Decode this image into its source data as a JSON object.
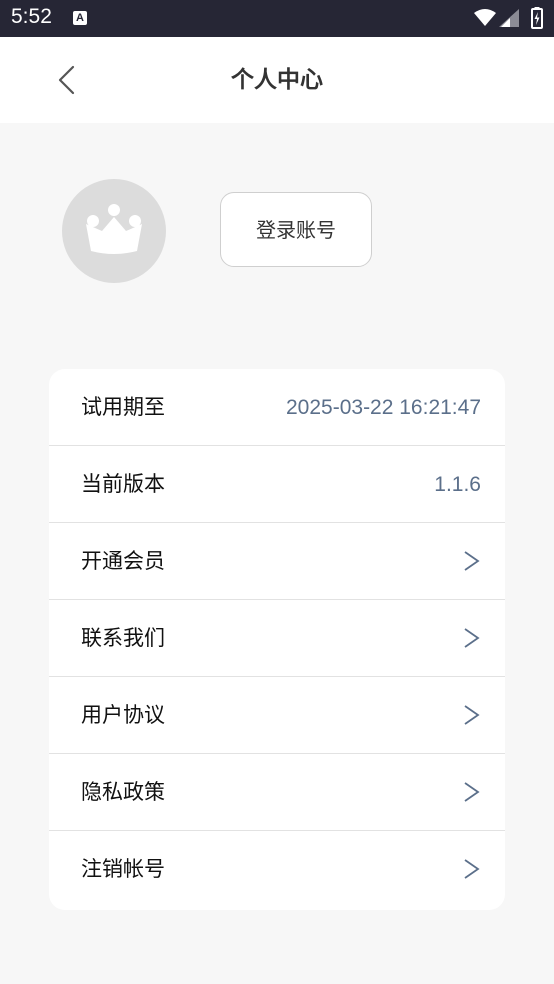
{
  "status_bar": {
    "time": "5:52",
    "notification_badge": "A",
    "icons": [
      "wifi-icon",
      "signal-icon",
      "battery-icon"
    ]
  },
  "header": {
    "title": "个人中心",
    "back_icon": "back-arrow-icon"
  },
  "profile": {
    "avatar_icon": "crown-icon",
    "login_label": "登录账号"
  },
  "menu": {
    "trial": {
      "label": "试用期至",
      "value": "2025-03-22 16:21:47"
    },
    "version": {
      "label": "当前版本",
      "value": "1.1.6"
    },
    "membership": {
      "label": "开通会员"
    },
    "contact": {
      "label": "联系我们"
    },
    "agreement": {
      "label": "用户协议"
    },
    "privacy": {
      "label": "隐私政策"
    },
    "cancel_account": {
      "label": "注销帐号"
    },
    "chevron_icon": "chevron-right-icon"
  },
  "colors": {
    "status_bar_bg": "#262635",
    "page_bg": "#f7f7f7",
    "value_text": "#5b6f8a",
    "avatar_bg": "#dcdcdc"
  }
}
